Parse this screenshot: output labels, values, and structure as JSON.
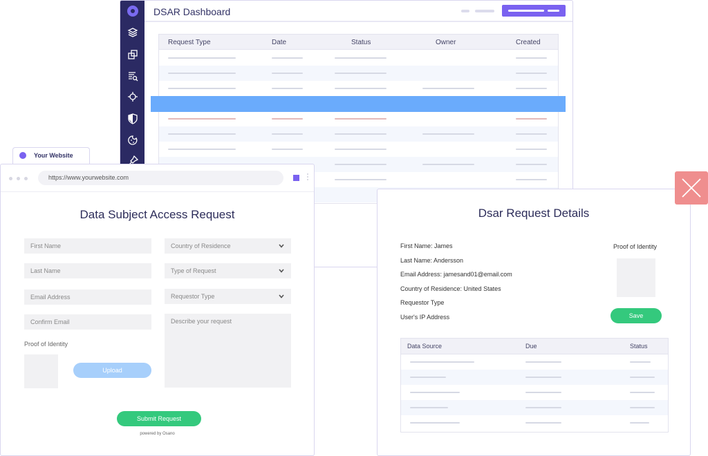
{
  "dashboard": {
    "title": "DSAR Dashboard",
    "icons": [
      "logo-icon",
      "layers-icon",
      "copy-icon",
      "list-search-icon",
      "target-icon",
      "shield-icon",
      "cookie-icon",
      "pin-icon"
    ],
    "columns": [
      "Request Type",
      "Date",
      "Status",
      "Owner",
      "Created"
    ],
    "highlight_color": "#6aabfc",
    "sidebar_color": "#2b2a63",
    "accent_color": "#7a62f0"
  },
  "website": {
    "tab_label": "Your Website",
    "url": "https://www.yourwebsite.com",
    "form_title": "Data Subject Access Request",
    "fields": {
      "first_name": "First Name",
      "last_name": "Last Name",
      "email": "Email Address",
      "confirm_email": "Confirm Email",
      "country": "Country of Residence",
      "request_type": "Type of Request",
      "requestor_type": "Requestor Type",
      "describe": "Describe your request"
    },
    "proof_label": "Proof of Identity",
    "upload_label": "Upload",
    "submit_label": "Submit Request",
    "powered_by": "powered by Osano"
  },
  "details": {
    "title": "Dsar Request Details",
    "info": [
      "First Name: James",
      "Last Name: Andersson",
      "Email Address: jamesand01@email.com",
      "Country of Residence: United States",
      "Requestor Type",
      "User's IP Address"
    ],
    "proof_label": "Proof of Identity",
    "save_label": "Save",
    "columns": [
      "Data Source",
      "Due",
      "Status"
    ],
    "button_color": "#34c97d",
    "close_color": "#ef8e8e"
  }
}
